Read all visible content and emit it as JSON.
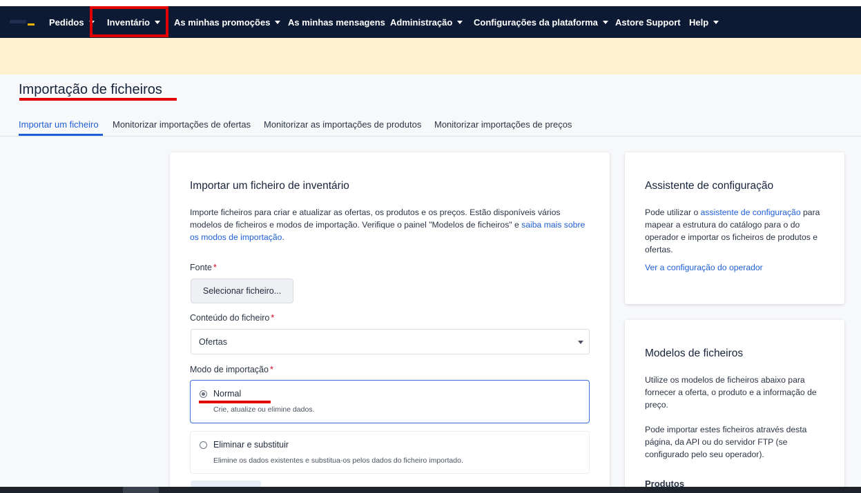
{
  "nav": {
    "items": [
      {
        "label": "Pedidos",
        "dropdown": true
      },
      {
        "label": "Inventário",
        "dropdown": true
      },
      {
        "label": "As minhas promoções",
        "dropdown": true
      },
      {
        "label": "As minhas mensagens",
        "dropdown": false
      },
      {
        "label": "Administração",
        "dropdown": true
      },
      {
        "label": "Configurações da plataforma",
        "dropdown": true
      },
      {
        "label": "Astore Support",
        "dropdown": false
      },
      {
        "label": "Help",
        "dropdown": true
      }
    ]
  },
  "page": {
    "title": "Importação de ficheiros"
  },
  "tabs": [
    {
      "label": "Importar um ficheiro",
      "active": true
    },
    {
      "label": "Monitorizar importações de ofertas",
      "active": false
    },
    {
      "label": "Monitorizar as importações de produtos",
      "active": false
    },
    {
      "label": "Monitorizar importações de preços",
      "active": false
    }
  ],
  "main": {
    "title": "Importar um ficheiro de inventário",
    "intro_text": "Importe ficheiros para criar e atualizar as ofertas, os produtos e os preços. Estão disponíveis vários modelos de ficheiros e modos de importação. Verifique o painel \"Modelos de ficheiros\" e ",
    "intro_link": "saiba mais sobre os modos de importação",
    "intro_end": ".",
    "source_label": "Fonte",
    "required_mark": "*",
    "select_file_button": "Selecionar ficheiro...",
    "content_label": "Conteúdo do ficheiro",
    "content_value": "Ofertas",
    "mode_label": "Modo de importação",
    "modes": [
      {
        "title": "Normal",
        "desc": "Crie, atualize ou elimine dados.",
        "selected": true
      },
      {
        "title": "Eliminar e substituir",
        "desc": "Elimine os dados existentes e substitua-os pelos dados do ficheiro importado.",
        "selected": false
      }
    ]
  },
  "side": {
    "wizard": {
      "title": "Assistente de configuração",
      "text_before": "Pode utilizar o ",
      "text_link": "assistente de configuração",
      "text_after": " para mapear a estrutura do catálogo para o do operador e importar os ficheiros de produtos e ofertas.",
      "view_link": "Ver a configuração do operador"
    },
    "templates": {
      "title": "Modelos de ficheiros",
      "para1": "Utilize os modelos de ficheiros abaixo para fornecer a oferta, o produto e a informação de preço.",
      "para2": "Pode importar estes ficheiros através desta página, da API ou do servidor FTP (se configurado pelo seu operador).",
      "section": "Produtos"
    }
  },
  "colors": {
    "nav_bg": "#0c1a33",
    "banner_bg": "#fff0cf",
    "accent": "#1f5ed7",
    "annotation": "#e20000"
  }
}
